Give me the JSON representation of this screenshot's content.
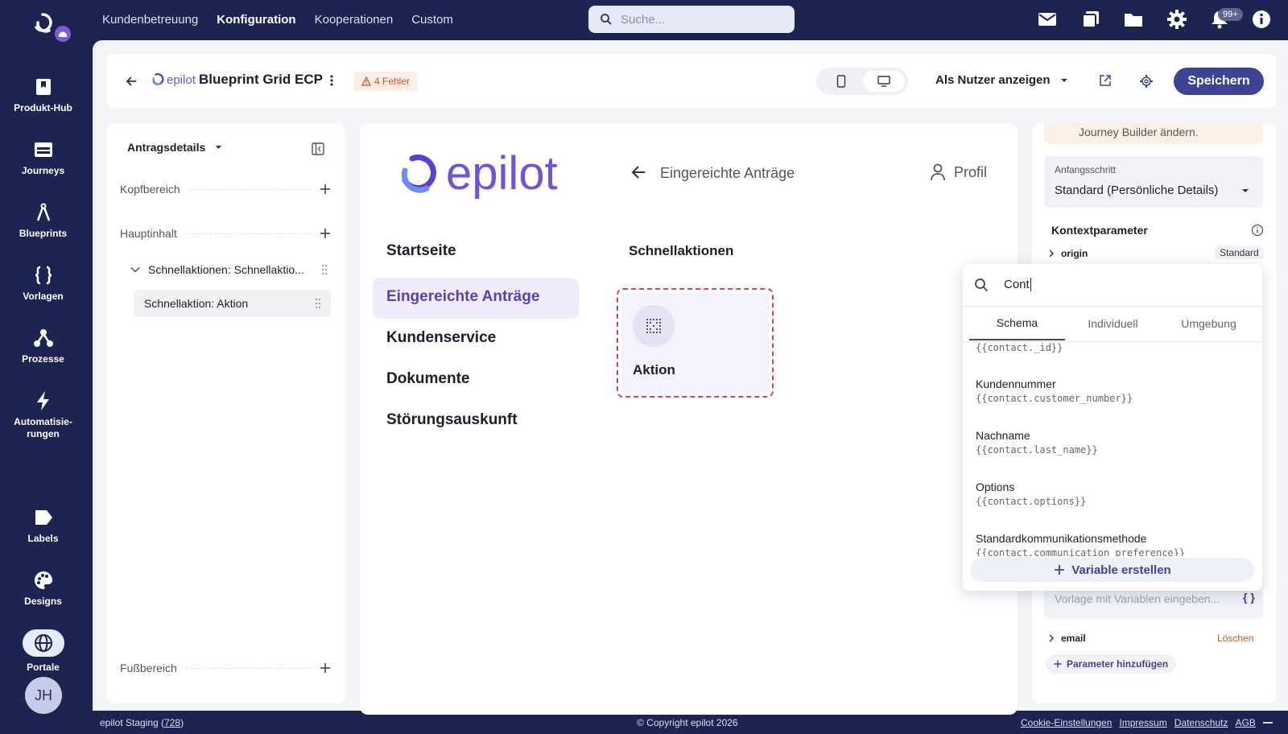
{
  "topnav": {
    "items": [
      "Kundenbetreuung",
      "Konfiguration",
      "Kooperationen",
      "Custom"
    ],
    "active": "Konfiguration"
  },
  "search": {
    "placeholder": "Suche..."
  },
  "notifications": {
    "badge": "99+"
  },
  "sidebar": {
    "items": [
      "Produkt-Hub",
      "Journeys",
      "Blueprints",
      "Vorlagen",
      "Prozesse",
      "Automatisie-rungen",
      "Labels",
      "Designs",
      "Portale"
    ],
    "active": "Portale",
    "avatar": "JH"
  },
  "header": {
    "title": "Blueprint Grid ECP",
    "brand": "epilot",
    "errors": "4 Fehler",
    "view_as": "Als Nutzer anzeigen",
    "save": "Speichern"
  },
  "left_panel": {
    "selector": "Antragsdetails",
    "sections": {
      "head": "Kopfbereich",
      "main": "Hauptinhalt",
      "foot": "Fußbereich"
    },
    "tree": {
      "parent": "Schnellaktionen: Schnellaktio...",
      "child": "Schnellaktion: Aktion"
    }
  },
  "canvas": {
    "logo": "epilot",
    "back_label": "Eingereichte Anträge",
    "profile": "Profil",
    "nav": [
      "Startseite",
      "Eingereichte Anträge",
      "Kundenservice",
      "Dokumente",
      "Störungsauskunft"
    ],
    "nav_active": "Eingereichte Anträge",
    "quick_actions_title": "Schnellaktionen",
    "action_label": "Aktion"
  },
  "right_panel": {
    "notice_tail": "Journey Builder ändern.",
    "start_step_label": "Anfangsschritt",
    "start_step_value": "Standard (Persönliche Details)",
    "context_title": "Kontextparameter",
    "param_origin": "origin",
    "param_origin_badge": "Standard",
    "template_placeholder": "Vorlage mit Variablen eingeben...",
    "param_email": "email",
    "delete": "Löschen",
    "add_param": "Parameter hinzufügen"
  },
  "dropdown": {
    "query": "Cont",
    "tabs": [
      "Schema",
      "Individuell",
      "Umgebung"
    ],
    "active_tab": "Schema",
    "items": [
      {
        "title": "",
        "var": "{{contact._id}}"
      },
      {
        "title": "Kundennummer",
        "var": "{{contact.customer_number}}"
      },
      {
        "title": "Nachname",
        "var": "{{contact.last_name}}"
      },
      {
        "title": "Options",
        "var": "{{contact.options}}"
      },
      {
        "title": "Standardkommunikationsmethode",
        "var": "{{contact.communication_preference}}"
      }
    ],
    "create": "Variable erstellen"
  },
  "footer": {
    "env": "epilot Staging",
    "build": "728",
    "copyright": "© Copyright epilot 2026",
    "links": [
      "Cookie-Einstellungen",
      "Impressum",
      "Datenschutz",
      "AGB"
    ]
  },
  "colors": {
    "navy": "#1e2452",
    "accent": "#3e4396",
    "brand": "#6c5ce7",
    "error_bg": "#fdeee4"
  }
}
